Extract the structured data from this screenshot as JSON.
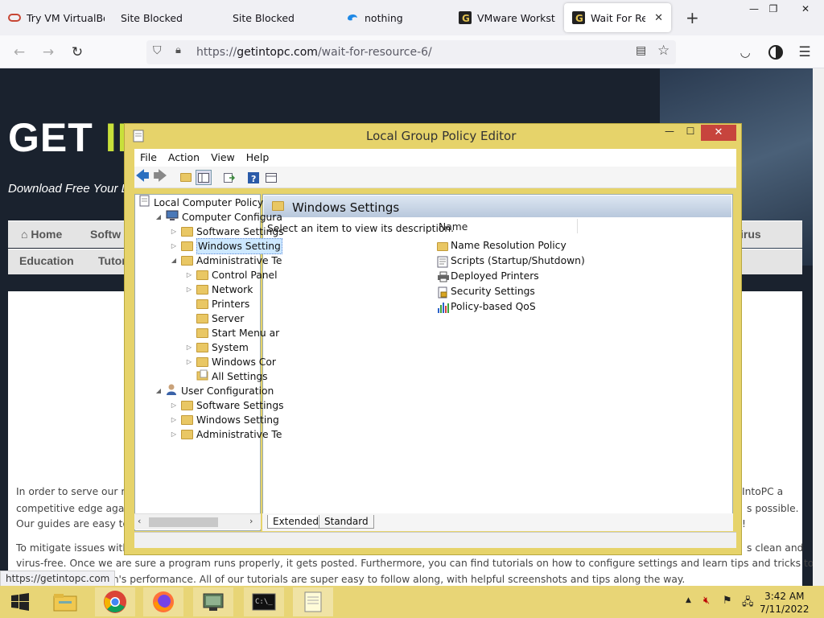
{
  "browser": {
    "tabs": [
      {
        "title": "Try VM VirtualBox",
        "icon": "oracle-icon"
      },
      {
        "title": "Site Blocked",
        "icon": "none"
      },
      {
        "title": "Site Blocked",
        "icon": "none"
      },
      {
        "title": "nothing",
        "icon": "edge-icon"
      },
      {
        "title": "VMware Workstati",
        "icon": "getintopc-icon"
      },
      {
        "title": "Wait For Resour",
        "icon": "getintopc-icon"
      }
    ],
    "new_tab": "+",
    "url_prefix": "https://",
    "url_domain": "getintopc.com",
    "url_path": "/wait-for-resource-6/"
  },
  "website": {
    "logo_white": "GET ",
    "logo_green": "INTO PC",
    "tagline": "Download Free Your D",
    "menu_row1": [
      "Home",
      "Softw",
      "irus"
    ],
    "menu_row2": [
      "Education",
      "Tutor"
    ],
    "para1_line1_left": "In order to serve our re",
    "para1_line1_right": "IntoPC a",
    "para1_line2_left": "competitive edge agai",
    "para1_line2_right": "s possible.",
    "para1_line3_left": "Our guides are easy to",
    "para1_line3_right": "!",
    "para2_line1_left": "To mitigate issues with",
    "para2_line1_right": "s clean and",
    "para2_line2": "virus-free. Once we are sure a program runs properly, it gets posted. Furthermore, you can find tutorials on how to configure settings and learn tips and tricks to",
    "para2_line3": "em's performance. All of our tutorials are super easy to follow along, with helpful screenshots and tips along the way.",
    "status_url": "https://getintopc.com"
  },
  "gpo": {
    "title": "Local Group Policy Editor",
    "menu": [
      "File",
      "Action",
      "View",
      "Help"
    ],
    "tree": [
      {
        "label": "Local Computer Policy",
        "indent": 0,
        "arrow": ""
      },
      {
        "label": "Computer Configura",
        "indent": 1,
        "arrow": "◢"
      },
      {
        "label": "Software Settings",
        "indent": 2,
        "arrow": "▷"
      },
      {
        "label": "Windows Setting",
        "indent": 2,
        "arrow": "▷"
      },
      {
        "label": "Administrative Te",
        "indent": 2,
        "arrow": "◢"
      },
      {
        "label": "Control Panel",
        "indent": 3,
        "arrow": "▷"
      },
      {
        "label": "Network",
        "indent": 3,
        "arrow": "▷"
      },
      {
        "label": "Printers",
        "indent": 3,
        "arrow": ""
      },
      {
        "label": "Server",
        "indent": 3,
        "arrow": ""
      },
      {
        "label": "Start Menu ar",
        "indent": 3,
        "arrow": ""
      },
      {
        "label": "System",
        "indent": 3,
        "arrow": "▷"
      },
      {
        "label": "Windows Cor",
        "indent": 3,
        "arrow": "▷"
      },
      {
        "label": "All Settings",
        "indent": 3,
        "arrow": ""
      },
      {
        "label": "User Configuration",
        "indent": 1,
        "arrow": "◢"
      },
      {
        "label": "Software Settings",
        "indent": 2,
        "arrow": "▷"
      },
      {
        "label": "Windows Setting",
        "indent": 2,
        "arrow": "▷"
      },
      {
        "label": "Administrative Te",
        "indent": 2,
        "arrow": "▷"
      }
    ],
    "right_title": "Windows Settings",
    "description": "Select an item to view its description.",
    "column_name": "Name",
    "items": [
      {
        "label": "Name Resolution Policy",
        "icon": "folder-icon"
      },
      {
        "label": "Scripts (Startup/Shutdown)",
        "icon": "script-icon"
      },
      {
        "label": "Deployed Printers",
        "icon": "printer-icon"
      },
      {
        "label": "Security Settings",
        "icon": "security-icon"
      },
      {
        "label": "Policy-based QoS",
        "icon": "qos-chart-icon"
      }
    ],
    "bottom_tabs": [
      "Extended",
      "Standard"
    ]
  },
  "taskbar": {
    "time": "3:42 AM",
    "date": "7/11/2022"
  }
}
